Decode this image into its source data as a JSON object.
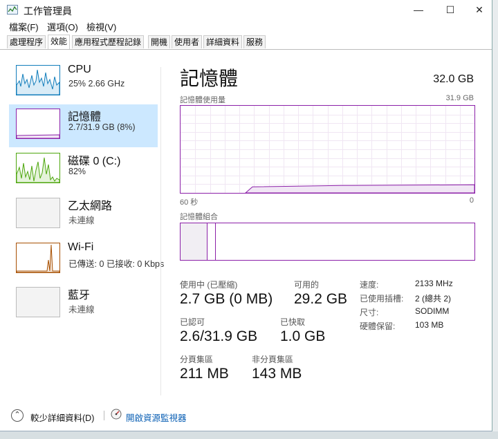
{
  "window": {
    "title": "工作管理員",
    "minimize_glyph": "—",
    "maximize_glyph": "☐",
    "close_glyph": "✕"
  },
  "menu": [
    "檔案(F)",
    "選項(O)",
    "檢視(V)"
  ],
  "tabs": [
    "處理程序",
    "效能",
    "應用程式歷程記錄",
    "開機",
    "使用者",
    "詳細資料",
    "服務"
  ],
  "active_tab": "效能",
  "resources": [
    {
      "name": "CPU",
      "sub": "25%  2.66 GHz",
      "icon": "cpu-graph-icon",
      "color": "#117dbb"
    },
    {
      "name": "記憶體",
      "sub": "2.7/31.9 GB (8%)",
      "icon": "memory-graph-icon",
      "color": "#8b1fa8"
    },
    {
      "name": "磁碟 0 (C:)",
      "sub": "82%",
      "icon": "disk-graph-icon",
      "color": "#4da60c"
    },
    {
      "name": "乙太網路",
      "sub": "未連線",
      "icon": "ethernet-graph-icon",
      "color": "#a74f01"
    },
    {
      "name": "Wi-Fi",
      "sub": "已傳送: 0  已接收: 0 Kbps",
      "icon": "wifi-graph-icon",
      "color": "#a74f01"
    },
    {
      "name": "藍牙",
      "sub": "未連線",
      "icon": "bluetooth-graph-icon",
      "color": "#a74f01"
    }
  ],
  "detail": {
    "title": "記憶體",
    "total": "32.0 GB",
    "usage_label": "記憶體使用量",
    "usage_max": "31.9 GB",
    "time_left": "60 秒",
    "time_right": "0",
    "composition_label": "記憶體組合",
    "usage_fraction": 0.085,
    "stats": {
      "in_use_label": "使用中 (已壓縮)",
      "in_use_value": "2.7 GB (0 MB)",
      "available_label": "可用的",
      "available_value": "29.2 GB",
      "committed_label": "已認可",
      "committed_value": "2.6/31.9 GB",
      "cached_label": "已快取",
      "cached_value": "1.0 GB",
      "paged_label": "分頁集區",
      "paged_value": "211 MB",
      "nonpaged_label": "非分頁集區",
      "nonpaged_value": "143 MB"
    },
    "props": [
      {
        "label": "速度:",
        "value": "2133 MHz"
      },
      {
        "label": "已使用插槽:",
        "value": "2 (總共 2)"
      },
      {
        "label": "尺寸:",
        "value": "SODIMM"
      },
      {
        "label": "硬體保留:",
        "value": "103 MB"
      }
    ]
  },
  "footer": {
    "fewer_details": "較少詳細資料(D)",
    "open_monitor": "開啟資源監視器"
  }
}
